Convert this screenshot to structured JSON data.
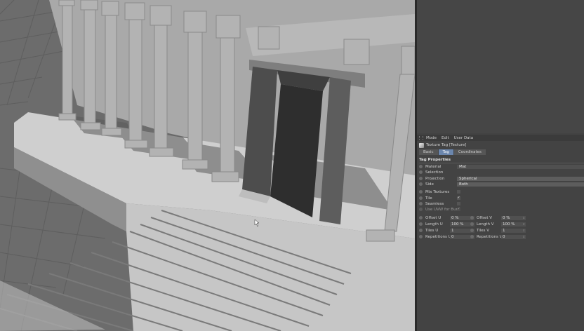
{
  "panel": {
    "menu": [
      "Mode",
      "Edit",
      "User Data"
    ],
    "title": "Texture Tag [Texture]",
    "tabs": [
      {
        "label": "Basic",
        "active": false
      },
      {
        "label": "Tag",
        "active": true
      },
      {
        "label": "Coordinates",
        "active": false
      }
    ],
    "section_title": "Tag Properties",
    "props": {
      "material": {
        "label": "Material",
        "value": "Mat"
      },
      "selection": {
        "label": "Selection",
        "value": ""
      },
      "projection": {
        "label": "Projection",
        "value": "Spherical"
      },
      "side": {
        "label": "Side",
        "value": "Both"
      },
      "mix_textures": {
        "label": "Mix Textures",
        "checked": false
      },
      "tile": {
        "label": "Tile",
        "checked": true
      },
      "seamless": {
        "label": "Seamless",
        "checked": false
      },
      "uvw_bump": {
        "label": "Use UVW for Bump",
        "checked": true
      }
    },
    "coords": {
      "offset_u": {
        "label": "Offset U",
        "value": "0 %"
      },
      "offset_v": {
        "label": "Offset V",
        "value": "0 %"
      },
      "length_u": {
        "label": "Length U",
        "value": "100 %"
      },
      "length_v": {
        "label": "Length V",
        "value": "100 %"
      },
      "tiles_u": {
        "label": "Tiles U",
        "value": "1"
      },
      "tiles_v": {
        "label": "Tiles V",
        "value": "1"
      },
      "repetitions_u": {
        "label": "Repetitions U",
        "value": "0"
      },
      "repetitions_v": {
        "label": "Repetitions V",
        "value": "0"
      }
    }
  }
}
